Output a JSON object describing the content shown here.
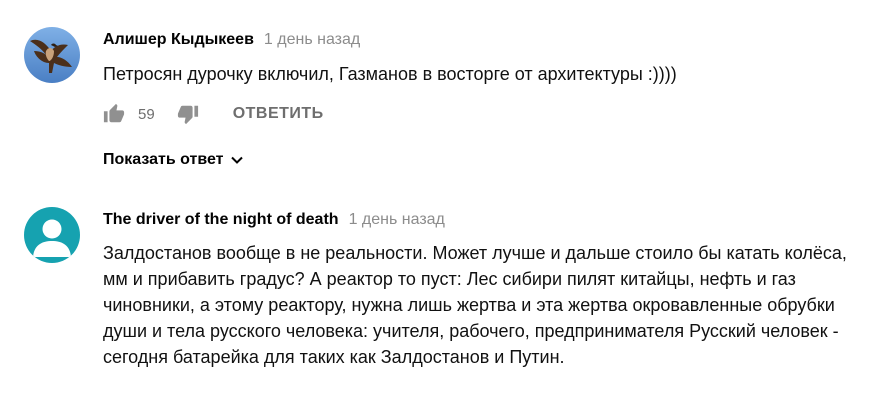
{
  "comments": [
    {
      "author": "Алишер Кыдыкеев",
      "time": "1 день назад",
      "text": "Петросян дурочку включил, Газманов в восторге от архитектуры :))))",
      "likes": "59",
      "reply_label": "ОТВЕТИТЬ",
      "show_replies_label": "Показать ответ",
      "avatar_icon": "eagle-photo-avatar"
    },
    {
      "author": "The driver of the night of death",
      "time": "1 день назад",
      "text": "Залдостанов вообще в не реальности. Может лучше и дальше стоило бы катать колёса, мм и прибавить градус? А реактор то пуст: Лес сибири пилят китайцы, нефть и газ чиновники, а этому реактору, нужна лишь жертва и эта жертва окровавленные обрубки души и тела русского человека: учителя, рабочего, предпринимателя  Русский человек - сегодня батарейка для таких как Залдостанов и Путин.",
      "avatar_icon": "default-user-avatar"
    }
  ],
  "colors": {
    "meta_gray": "#8c8c8c",
    "action_gray": "#6e6e6e",
    "avatar_default_bg": "#16a2b0"
  }
}
